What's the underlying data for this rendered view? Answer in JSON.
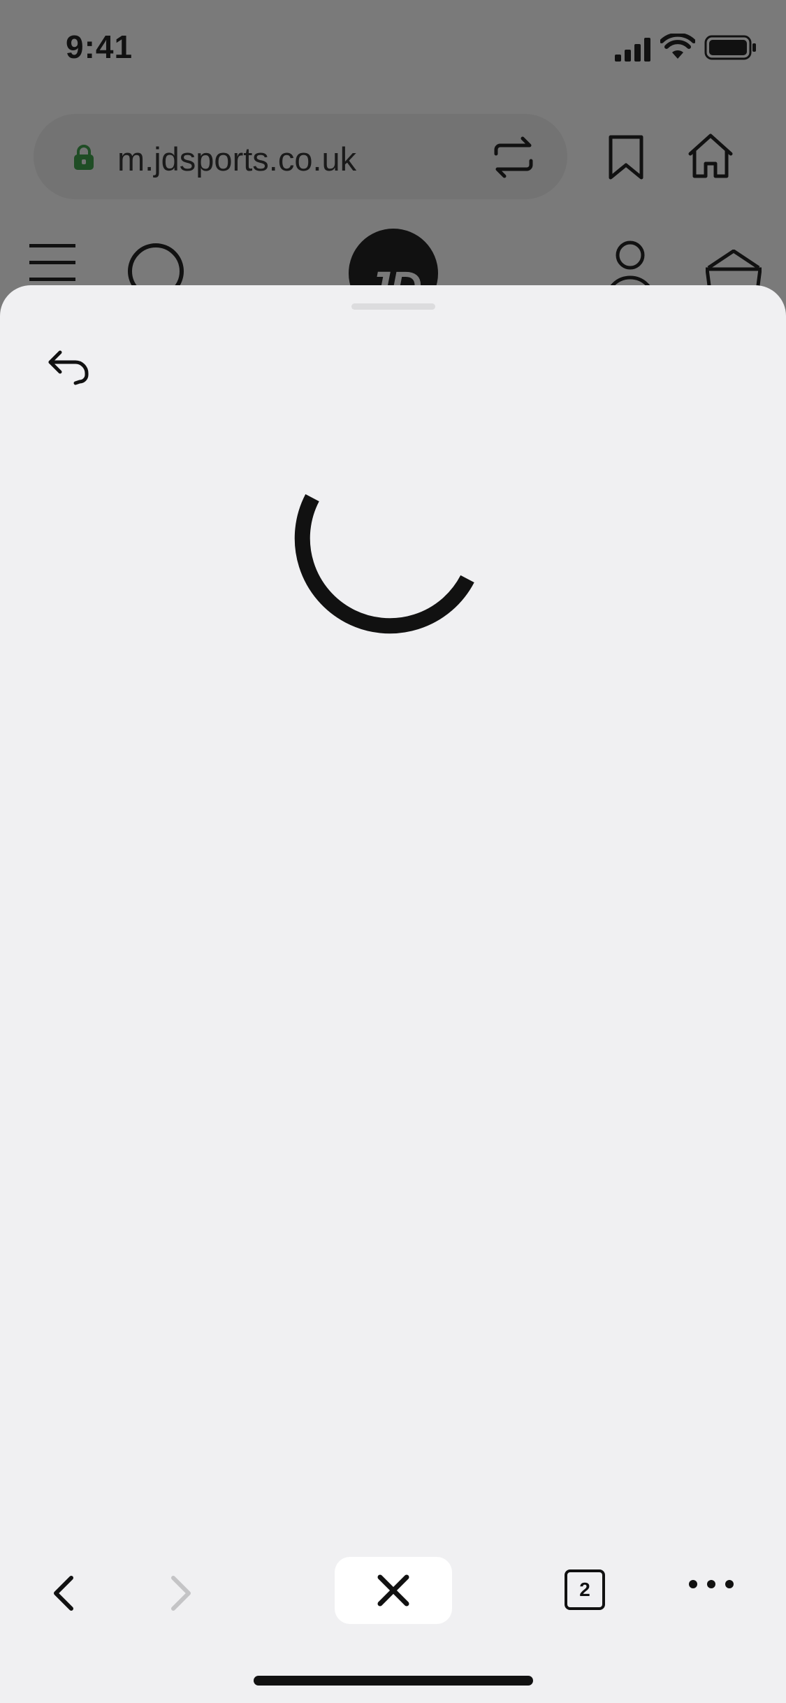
{
  "status_bar": {
    "time": "9:41"
  },
  "browser": {
    "url": "m.jdsports.co.uk",
    "icons": [
      "lock-icon",
      "translate-icon",
      "bookmark-icon",
      "home-icon"
    ]
  },
  "site_header": {
    "logo_text": "JD",
    "icons": [
      "menu-icon",
      "search-icon",
      "account-icon",
      "basket-icon"
    ]
  },
  "sheet": {
    "icons": [
      "reply-back-icon",
      "loading-spinner"
    ]
  },
  "toolbar": {
    "tab_count": "2",
    "icons": [
      "chevron-left-icon",
      "chevron-right-icon",
      "close-icon",
      "tabs-icon",
      "more-icon"
    ]
  },
  "colors": {
    "dim_overlay": "#7a7a7a",
    "sheet_bg": "#f0f0f2",
    "lock_green": "#1f4d25"
  }
}
